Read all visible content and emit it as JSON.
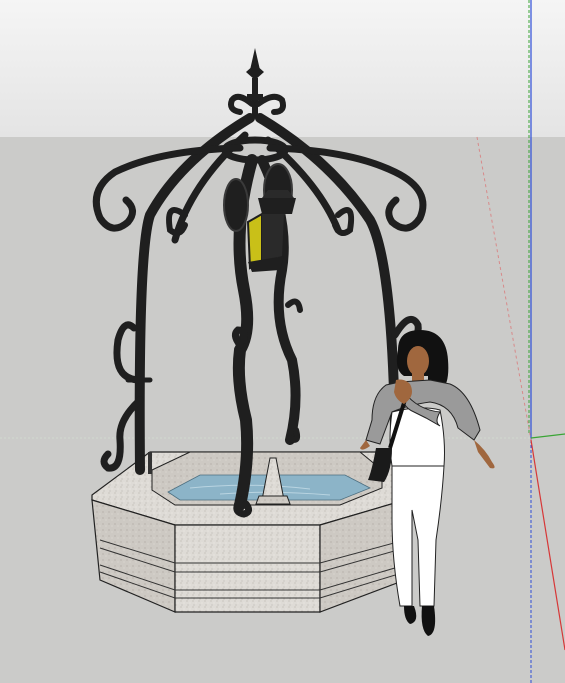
{
  "app": {
    "kind": "3d-modeling-viewport"
  },
  "colors": {
    "sky_top": "#f4f4f4",
    "sky_bottom": "#e6e6e6",
    "ground": "#cbcbc9",
    "iron": "#1f1f1f",
    "lantern_glass": "#c9c018",
    "stone": "#dedbd6",
    "stone_dark": "#c9c5bf",
    "water": "#8cb4c8",
    "axis_green": "#3aa535",
    "axis_blue": "#2f4ed8",
    "axis_red": "#d78a8a",
    "figure_skin": "#a0673e",
    "figure_hair": "#111111",
    "figure_cardigan": "#9a9a9a",
    "figure_clothes": "#ffffff"
  },
  "scene": {
    "model": "well-fountain-icon",
    "ornament": "wrought-iron-canopy-icon",
    "light": "lantern-icon",
    "scale_figure": "person-figure-icon",
    "axes": [
      "green-axis",
      "blue-axis",
      "red-axis"
    ]
  }
}
